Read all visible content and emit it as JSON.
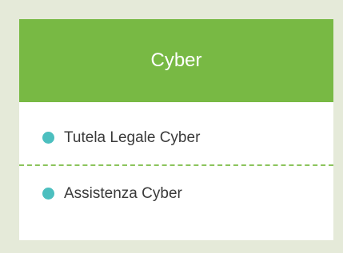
{
  "card": {
    "title": "Cyber",
    "items": [
      {
        "label": "Tutela Legale Cyber"
      },
      {
        "label": "Assistenza Cyber"
      }
    ]
  },
  "colors": {
    "background": "#e5ead9",
    "header": "#78b944",
    "bullet": "#4cbfbf",
    "divider": "#8cc45c",
    "text": "#3a3a3a"
  },
  "icons": {
    "bullet": "bullet-dot-icon"
  }
}
